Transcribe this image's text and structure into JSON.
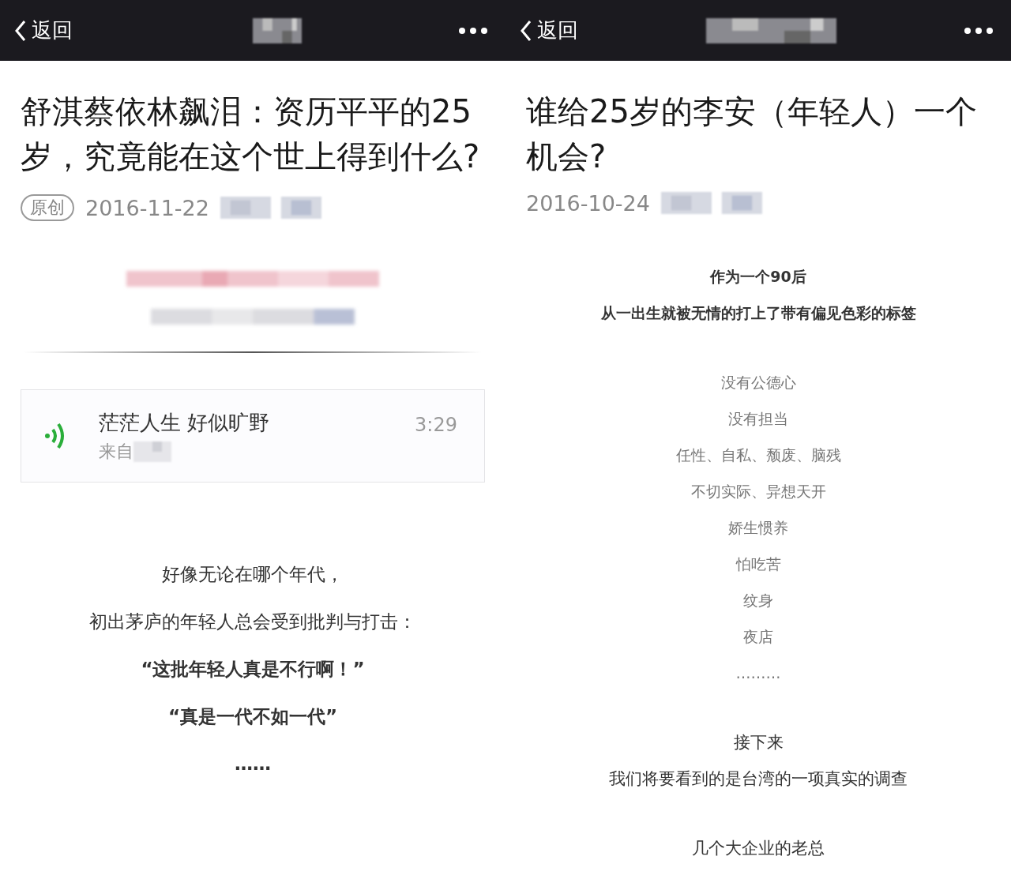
{
  "panels": [
    {
      "nav": {
        "back": "返回"
      },
      "title": "舒淇蔡依林飙泪：资历平平的25岁，究竟能在这个世上得到什么?",
      "original_badge": "原创",
      "date": "2016-11-22",
      "intro_blurred": true,
      "audio": {
        "title": "茫茫人生 好似旷野",
        "source": "来自",
        "duration": "3:29"
      },
      "sections": [
        [
          {
            "text": "好像无论在哪个年代，",
            "bold": false,
            "muted": false
          },
          {
            "text": "初出茅庐的年轻人总会受到批判与打击：",
            "bold": false,
            "muted": false
          },
          {
            "text": "“这批年轻人真是不行啊！”",
            "bold": true,
            "muted": false
          },
          {
            "text": "“真是一代不如一代”",
            "bold": true,
            "muted": false
          },
          {
            "text": "……",
            "bold": true,
            "muted": false
          }
        ]
      ]
    },
    {
      "nav": {
        "back": "返回"
      },
      "title": "谁给25岁的李安（年轻人）一个机会?",
      "date": "2016-10-24",
      "intro_blurred": false,
      "sections": [
        [
          {
            "text": "作为一个90后",
            "bold": true,
            "muted": false
          },
          {
            "text": "从一出生就被无情的打上了带有偏见色彩的标签",
            "bold": true,
            "muted": false
          }
        ],
        [
          {
            "text": "没有公德心",
            "bold": false,
            "muted": true
          },
          {
            "text": "没有担当",
            "bold": false,
            "muted": true
          },
          {
            "text": "任性、自私、颓废、脑残",
            "bold": false,
            "muted": true
          },
          {
            "text": "不切实际、异想天开",
            "bold": false,
            "muted": true
          },
          {
            "text": "娇生惯养",
            "bold": false,
            "muted": true
          },
          {
            "text": "怕吃苦",
            "bold": false,
            "muted": true
          },
          {
            "text": "纹身",
            "bold": false,
            "muted": true
          },
          {
            "text": "夜店",
            "bold": false,
            "muted": true
          },
          {
            "text": "………",
            "bold": false,
            "muted": true
          }
        ],
        [
          {
            "text": "接下来",
            "bold": false,
            "muted": false
          },
          {
            "text": "我们将要看到的是台湾的一项真实的调查",
            "bold": false,
            "muted": false
          }
        ],
        [
          {
            "text": "几个大企业的老总",
            "bold": false,
            "muted": false
          }
        ]
      ]
    }
  ]
}
